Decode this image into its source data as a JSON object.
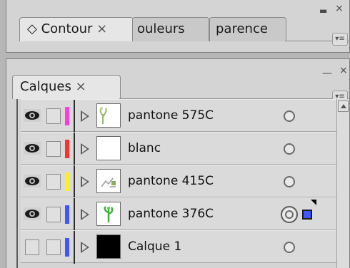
{
  "top_panel": {
    "tabs": [
      {
        "label": "◇ Contour",
        "close": "×",
        "active": true
      },
      {
        "label": "ouleurs",
        "active": false
      },
      {
        "label": "parence",
        "active": false
      }
    ],
    "window_minimize_glyph": "▬",
    "window_close_glyph": "×",
    "menu_glyph": "▾≡"
  },
  "layers_panel": {
    "tab_label": "Calques",
    "close": "×",
    "window_minimize_glyph": "—",
    "window_close_glyph": "×",
    "menu_glyph": "▾≡",
    "layers": [
      {
        "name": "pantone 575C",
        "visible": true,
        "color": "#ff3ddd",
        "thumbnail": "plant-thumbnail-icon",
        "targeted": false
      },
      {
        "name": "blanc",
        "visible": true,
        "color": "#ff3030",
        "thumbnail": "blank-thumbnail",
        "targeted": false
      },
      {
        "name": "pantone 415C",
        "visible": true,
        "color": "#ffee20",
        "thumbnail": "sketch-thumbnail-icon",
        "targeted": false
      },
      {
        "name": "pantone 376C",
        "visible": true,
        "color": "#3f57ff",
        "thumbnail": "green-plant-thumbnail-icon",
        "targeted": true,
        "selected_art_color": "#3f57ff"
      },
      {
        "name": "Calque 1",
        "visible": false,
        "color": "#3f57ff",
        "thumbnail": "black-thumbnail",
        "targeted": false
      }
    ]
  },
  "colors": {
    "panel_bg": "#d4d4d4",
    "row_bg": "#dadada",
    "frame_bg": "#b6b6b6"
  }
}
